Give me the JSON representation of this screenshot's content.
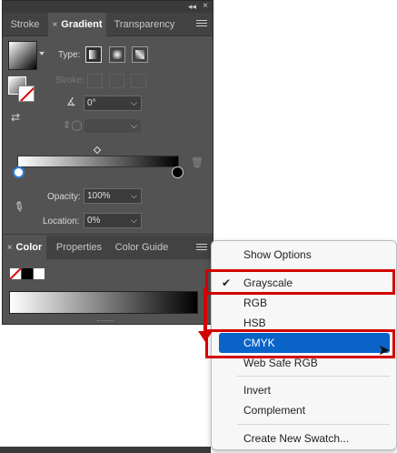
{
  "panel": {
    "tabs": [
      "Stroke",
      "Gradient",
      "Transparency"
    ],
    "active_tab": "Gradient",
    "close_glyph": "×",
    "type_label": "Type:",
    "stroke_label": "Stroke:",
    "angle_value": "0°",
    "opacity_label": "Opacity:",
    "opacity_value": "100%",
    "location_label": "Location:",
    "location_value": "0%"
  },
  "color_panel": {
    "tabs": [
      "Color",
      "Properties",
      "Color Guide"
    ],
    "active_tab": "Color"
  },
  "flyout_menu": {
    "items": {
      "show_options": "Show Options",
      "grayscale": "Grayscale",
      "rgb": "RGB",
      "hsb": "HSB",
      "cmyk": "CMYK",
      "web_safe_rgb": "Web Safe RGB",
      "invert": "Invert",
      "complement": "Complement",
      "create_new_swatch": "Create New Swatch..."
    },
    "checked": "Grayscale",
    "highlighted": "CMYK"
  },
  "colors": {
    "highlight": "#0a64c8",
    "callout": "#d40000",
    "panel_bg": "#535353"
  },
  "icons": [
    "collapse-icon",
    "close-icon",
    "panel-menu-icon",
    "gradient-thumbnail",
    "swap-fill-stroke-icon",
    "linear-gradient-icon",
    "radial-gradient-icon",
    "freeform-gradient-icon",
    "angle-icon",
    "aspect-ratio-icon",
    "trash-icon",
    "eyedropper-icon",
    "checkmark-icon",
    "cursor-icon"
  ]
}
